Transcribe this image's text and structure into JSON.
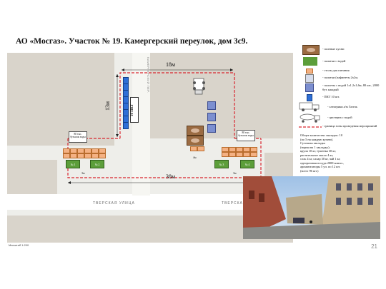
{
  "title": "АО «Мосгаз». Участок № 19. Камергерский переулок, дом 3с9.",
  "map": {
    "street_main": "ТВЕРСКАЯ УЛИЦА",
    "street_side": "КАМЕРГЕРСКИЙ ПЕР.",
    "dim_top": "18м",
    "dim_vertical": "13м",
    "dim_bottom": "38м",
    "dim_small_left": "3м",
    "dim_small_mid": "4м",
    "dim_small_right": "3м",
    "pkt_label": "10 ПКТ",
    "box_left": "80 тыс. бутылок воды",
    "box_right": "80 тыс. бутылок воды",
    "tent_labels": [
      "№ 1",
      "№ 2",
      "№ 3",
      "№ 4"
    ]
  },
  "legend": {
    "items": [
      {
        "icon": "field-kitchen-icon",
        "text": "- полевые кухни"
      },
      {
        "icon": "water-tent-icon",
        "text": "- палатки с водой"
      },
      {
        "icon": "dining-table-icon",
        "text": "- столы для питания"
      },
      {
        "icon": "pavilion-icon",
        "text": "- палатки (пафинеты 2х2м,"
      },
      {
        "icon": "water-pallet-icon",
        "text": "- паллеты с водой 1х1.2х1,6м, 80 шт., 2000 бут. каждый"
      },
      {
        "icon": "pkt-icon",
        "text": "- ПКТ 10 шт."
      },
      {
        "icon": "truck-icon",
        "text": "- электрики а/м Газель"
      },
      {
        "icon": "tanker-icon",
        "text": "- цистерна с водой"
      },
      {
        "icon": "zone-boundary-icon",
        "text": "- граница зоны проведения мероприятий"
      }
    ],
    "notes": [
      "Общее количество закладок: 10",
      "(по 5 на каждую кухню).",
      "Суточная закладка",
      "(норма на 1 закладку):",
      "крупа 10 кг, тушенка 30 кг,",
      "растительное масло 4 кг,",
      "соль 4 кг, сахар 30 кг, чай 1 кг,",
      "одноразовая посуда 2000 компл.,",
      "ароматизаторы 5 уп. по 12 шт.",
      "(всего 96 шт.)"
    ]
  },
  "footer_scale": "Масштаб 1:200",
  "page_number": "21",
  "colors": {
    "zone": "#d9262f",
    "tent": "#5c9e3a",
    "table": "#f4b183",
    "pkt": "#2f6fd6",
    "kitchen": "#9b6b42"
  }
}
